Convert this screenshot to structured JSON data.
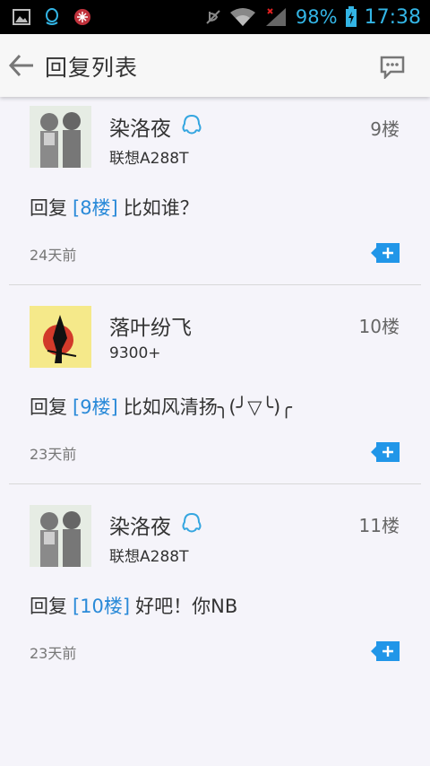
{
  "status_bar": {
    "battery": "98%",
    "time": "17:38",
    "icons": [
      "image-icon",
      "qq-penguin-icon",
      "app-badge-icon",
      "mute-icon",
      "wifi-icon",
      "signal-icon",
      "battery-icon"
    ]
  },
  "header": {
    "title": "回复列表",
    "back_icon": "back-arrow-icon",
    "action_icon": "message-icon"
  },
  "colors": {
    "accent": "#33b5e5",
    "link": "#2a8ad8",
    "plus_button": "#2196e8"
  },
  "replies": [
    {
      "username": "染洛夜",
      "has_qq_badge": true,
      "device": "联想A288T",
      "floor": "9楼",
      "reply_prefix": "回复",
      "reply_ref": "[8楼]",
      "reply_text": "比如谁？",
      "time": "24天前"
    },
    {
      "username": "落叶纷飞",
      "has_qq_badge": false,
      "device": "9300+",
      "floor": "10楼",
      "reply_prefix": "回复",
      "reply_ref": "[9楼]",
      "reply_text": "比如风清扬╮(╯▽╰)╭",
      "time": "23天前"
    },
    {
      "username": "染洛夜",
      "has_qq_badge": true,
      "device": "联想A288T",
      "floor": "11楼",
      "reply_prefix": "回复",
      "reply_ref": "[10楼]",
      "reply_text": "好吧！你NB",
      "time": "23天前"
    }
  ]
}
